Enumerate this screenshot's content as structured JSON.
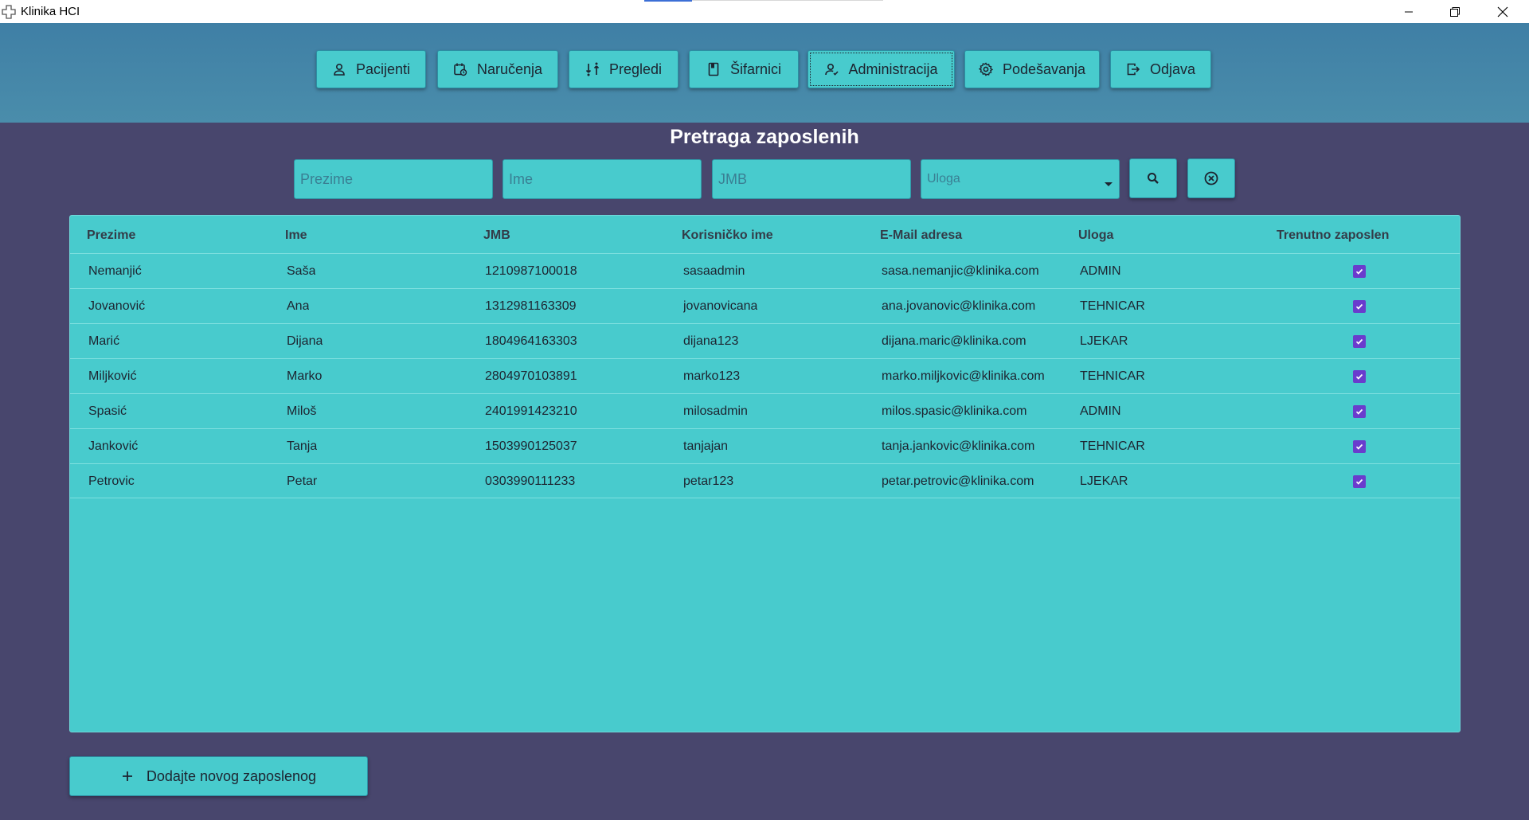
{
  "window": {
    "title": "Klinika HCI"
  },
  "nav": [
    {
      "label": "Pacijenti",
      "icon": "user-icon"
    },
    {
      "label": "Naručenja",
      "icon": "calendar-icon"
    },
    {
      "label": "Pregledi",
      "icon": "exchange-icon"
    },
    {
      "label": "Šifarnici",
      "icon": "book-icon"
    },
    {
      "label": "Administracija",
      "icon": "user-admin-icon",
      "active": true
    },
    {
      "label": "Podešavanja",
      "icon": "gear-icon"
    },
    {
      "label": "Odjava",
      "icon": "logout-icon"
    }
  ],
  "search": {
    "title": "Pretraga zaposlenih",
    "surname_placeholder": "Prezime",
    "name_placeholder": "Ime",
    "jmb_placeholder": "JMB",
    "role_placeholder": "Uloga"
  },
  "table": {
    "headers": [
      "Prezime",
      "Ime",
      "JMB",
      "Korisničko ime",
      "E-Mail adresa",
      "Uloga",
      "Trenutno zaposlen"
    ],
    "rows": [
      {
        "prezime": "Nemanjić",
        "ime": "Saša",
        "jmb": "1210987100018",
        "korisnicko": "sasaadmin",
        "email": "sasa.nemanjic@klinika.com",
        "uloga": "ADMIN",
        "zaposlen": true
      },
      {
        "prezime": "Jovanović",
        "ime": "Ana",
        "jmb": "1312981163309",
        "korisnicko": "jovanovicana",
        "email": "ana.jovanovic@klinika.com",
        "uloga": "TEHNICAR",
        "zaposlen": true
      },
      {
        "prezime": "Marić",
        "ime": "Dijana",
        "jmb": "1804964163303",
        "korisnicko": "dijana123",
        "email": "dijana.maric@klinika.com",
        "uloga": "LJEKAR",
        "zaposlen": true
      },
      {
        "prezime": "Miljković",
        "ime": "Marko",
        "jmb": "2804970103891",
        "korisnicko": "marko123",
        "email": "marko.miljkovic@klinika.com",
        "uloga": "TEHNICAR",
        "zaposlen": true
      },
      {
        "prezime": "Spasić",
        "ime": "Miloš",
        "jmb": "2401991423210",
        "korisnicko": "milosadmin",
        "email": "milos.spasic@klinika.com",
        "uloga": "ADMIN",
        "zaposlen": true
      },
      {
        "prezime": "Janković",
        "ime": "Tanja",
        "jmb": "1503990125037",
        "korisnicko": "tanjajan",
        "email": "tanja.jankovic@klinika.com",
        "uloga": "TEHNICAR",
        "zaposlen": true
      },
      {
        "prezime": "Petrovic",
        "ime": "Petar",
        "jmb": "0303990111233",
        "korisnicko": "petar123",
        "email": "petar.petrovic@klinika.com",
        "uloga": "LJEKAR",
        "zaposlen": true
      }
    ]
  },
  "actions": {
    "add_label": "Dodajte novog zaposlenog"
  },
  "colors": {
    "accent": "#48cbcd",
    "background": "#48466d",
    "header": "#3f7fa5",
    "checkbox": "#6a3ccd"
  }
}
